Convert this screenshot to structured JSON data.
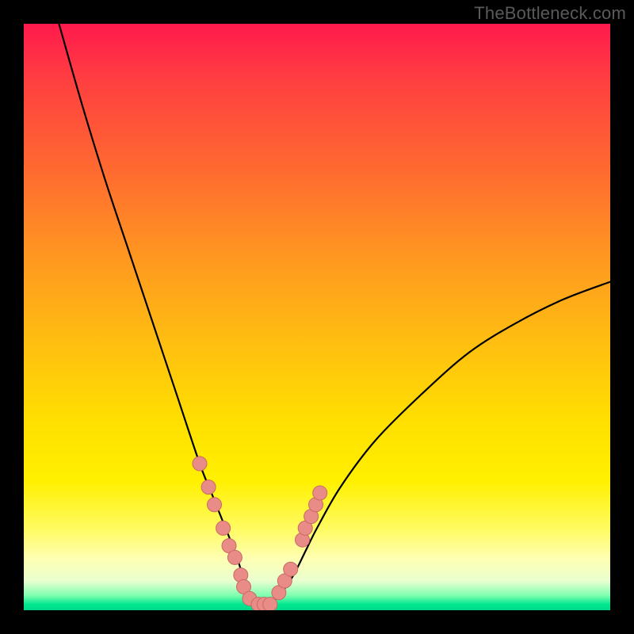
{
  "watermark": "TheBottleneck.com",
  "colors": {
    "frame": "#000000",
    "curve": "#000000",
    "marker_fill": "#e98b86",
    "marker_stroke": "#c96a64"
  },
  "chart_data": {
    "type": "line",
    "title": "",
    "xlabel": "",
    "ylabel": "",
    "xlim": [
      0,
      100
    ],
    "ylim": [
      0,
      100
    ],
    "grid": false,
    "series": [
      {
        "name": "bottleneck-curve",
        "x": [
          6,
          10,
          14,
          18,
          22,
          26,
          30,
          32,
          34,
          36,
          37,
          38,
          39,
          40,
          41,
          42,
          43,
          44,
          46,
          48,
          50,
          54,
          60,
          68,
          76,
          84,
          92,
          100
        ],
        "y": [
          100,
          86,
          73,
          61,
          49,
          37,
          25,
          20,
          15,
          10,
          7,
          4,
          2,
          1,
          1,
          1,
          2,
          3,
          6,
          10,
          14,
          21,
          29,
          37,
          44,
          49,
          53,
          56
        ]
      }
    ],
    "markers": {
      "name": "highlight-points",
      "x": [
        30,
        31.5,
        32.5,
        34,
        35,
        36,
        37,
        37.5,
        38.5,
        40,
        41,
        42,
        43.5,
        44.5,
        45.5,
        47.5,
        48,
        49,
        49.8,
        50.5
      ],
      "y": [
        25,
        21,
        18,
        14,
        11,
        9,
        6,
        4,
        2,
        1,
        1,
        1,
        3,
        5,
        7,
        12,
        14,
        16,
        18,
        20
      ]
    }
  }
}
